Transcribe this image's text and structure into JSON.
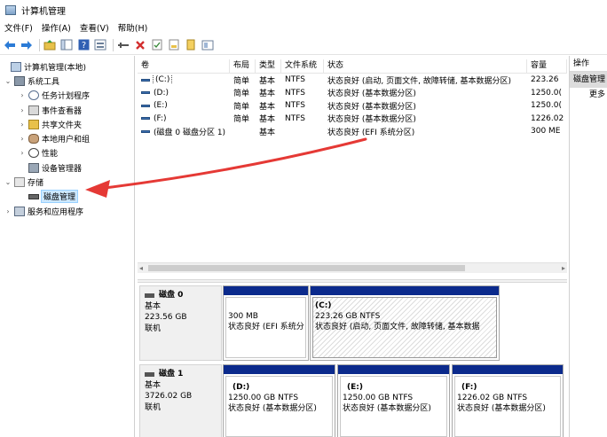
{
  "window": {
    "title": "计算机管理"
  },
  "menu": [
    "文件(F)",
    "操作(A)",
    "查看(V)",
    "帮助(H)"
  ],
  "toolbar": {
    "icons": [
      "back-arrow-icon",
      "forward-arrow-icon",
      "up-folder-icon",
      "show-tree-icon",
      "help-icon",
      "view-icon",
      "connect-icon",
      "delete-icon",
      "check-icon",
      "format-icon",
      "explore-icon",
      "properties-icon"
    ],
    "delete_color": "#d32f2f"
  },
  "tree": {
    "root": "计算机管理(本地)",
    "system_tools": "系统工具",
    "task_scheduler": "任务计划程序",
    "event_viewer": "事件查看器",
    "shared_folders": "共享文件夹",
    "local_users": "本地用户和组",
    "performance": "性能",
    "device_manager": "设备管理器",
    "storage": "存储",
    "disk_management": "磁盘管理",
    "services_apps": "服务和应用程序"
  },
  "volume_list": {
    "headers": [
      "卷",
      "布局",
      "类型",
      "文件系统",
      "状态",
      "容量"
    ],
    "rows": [
      {
        "volume": "(C:)",
        "layout": "简单",
        "type": "基本",
        "fs": "NTFS",
        "status": "状态良好 (启动, 页面文件, 故障转储, 基本数据分区)",
        "capacity": "223.26"
      },
      {
        "volume": "(D:)",
        "layout": "简单",
        "type": "基本",
        "fs": "NTFS",
        "status": "状态良好 (基本数据分区)",
        "capacity": "1250.0("
      },
      {
        "volume": "(E:)",
        "layout": "简单",
        "type": "基本",
        "fs": "NTFS",
        "status": "状态良好 (基本数据分区)",
        "capacity": "1250.0("
      },
      {
        "volume": "(F:)",
        "layout": "简单",
        "type": "基本",
        "fs": "NTFS",
        "status": "状态良好 (基本数据分区)",
        "capacity": "1226.02"
      },
      {
        "volume": "(磁盘 0 磁盘分区 1)",
        "layout": "简单",
        "type": "基本",
        "fs": "",
        "status": "状态良好 (EFI 系统分区)",
        "capacity": "300 ME"
      }
    ]
  },
  "disks": [
    {
      "name": "磁盘 0",
      "kind": "基本",
      "size": "223.56 GB",
      "state": "联机",
      "partitions": [
        {
          "label": "",
          "size": "300 MB",
          "status": "状态良好 (EFI 系统分"
        },
        {
          "label": "(C:)",
          "size": "223.26 GB NTFS",
          "status": "状态良好 (启动, 页面文件, 故障转储, 基本数据"
        }
      ]
    },
    {
      "name": "磁盘 1",
      "kind": "基本",
      "size": "3726.02 GB",
      "state": "联机",
      "partitions": [
        {
          "label": "(D:)",
          "size": "1250.00 GB NTFS",
          "status": "状态良好 (基本数据分区)"
        },
        {
          "label": "(E:)",
          "size": "1250.00 GB NTFS",
          "status": "状态良好 (基本数据分区)"
        },
        {
          "label": "(F:)",
          "size": "1226.02 GB NTFS",
          "status": "状态良好 (基本数据分区)"
        }
      ]
    }
  ],
  "actions": {
    "header": "操作",
    "selected": "磁盘管理",
    "more": "更多"
  },
  "colors": {
    "partition_bar": "#0b2a8c",
    "annotation_arrow": "#e53935",
    "selection": "#cce8ff"
  }
}
